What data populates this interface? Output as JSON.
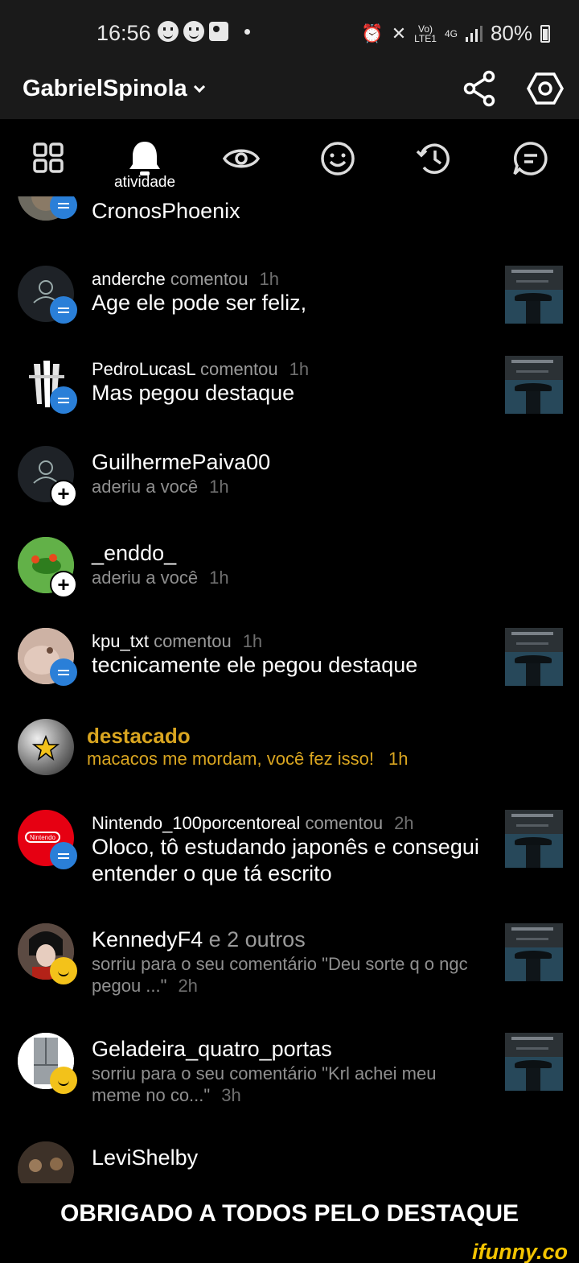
{
  "status_bar": {
    "time": "16:56",
    "network_top": "Vo)",
    "network_bottom": "LTE1",
    "net_type": "4G",
    "battery": "80%",
    "icons": [
      "face-icon",
      "face-icon",
      "image-icon",
      "alarm-icon",
      "mute-icon",
      "signal-icon",
      "battery-icon"
    ]
  },
  "header": {
    "username": "GabrielSpinola",
    "icons": [
      "chevron-down-icon",
      "share-icon",
      "settings-icon"
    ]
  },
  "tabs": {
    "active_label": "atividade",
    "items": [
      "grid-icon",
      "bell-icon",
      "eye-icon",
      "smile-icon",
      "history-icon",
      "chat-icon"
    ]
  },
  "notifications": [
    {
      "user": "CronosPhoenix",
      "badge": "comment"
    },
    {
      "user": "anderche",
      "verb": "comentou",
      "time": "1h",
      "text": "Age ele pode ser feliz,",
      "badge": "comment"
    },
    {
      "user": "PedroLucasL",
      "verb": "comentou",
      "time": "1h",
      "text": "Mas pegou destaque",
      "badge": "comment"
    },
    {
      "user": "GuilhermePaiva00",
      "text": "aderiu a você",
      "time": "1h",
      "badge": "follow"
    },
    {
      "user": "_enddo_",
      "text": "aderiu a você",
      "time": "1h",
      "badge": "follow"
    },
    {
      "user": "kpu_txt",
      "verb": "comentou",
      "time": "1h",
      "text": "tecnicamente ele pegou destaque",
      "badge": "comment"
    },
    {
      "title": "destacado",
      "text": "macacos me mordam, você fez isso!",
      "time": "1h",
      "badge": "star"
    },
    {
      "user": "Nintendo_100porcentoreal",
      "verb": "comentou",
      "time": "2h",
      "text_line1": "Oloco, tô estudando japonês e consegui",
      "text_line2": "entender o que tá escrito",
      "badge": "comment"
    },
    {
      "user": "KennedyF4",
      "extra": "e 2 outros",
      "text_line1": "sorriu para o seu comentário \"Deu sorte q o ngc",
      "text_line2": "pegou ...\"",
      "time": "2h",
      "badge": "smile"
    },
    {
      "user": "Geladeira_quatro_portas",
      "text_line1": "sorriu para o seu comentário \"Krl achei meu",
      "text_line2": "meme no co...\"",
      "time": "3h",
      "badge": "smile"
    },
    {
      "user": "LeviShelby"
    }
  ],
  "avatar_logo_text": "Nintendo",
  "footer": {
    "caption": "OBRIGADO A TODOS PELO DESTAQUE"
  },
  "watermark": "ifunny.co",
  "colors": {
    "background": "#000000",
    "header": "#1a1a1a",
    "featured": "#d9a520",
    "comment_badge": "#2a7fd8",
    "smile_badge": "#f3c21a"
  }
}
